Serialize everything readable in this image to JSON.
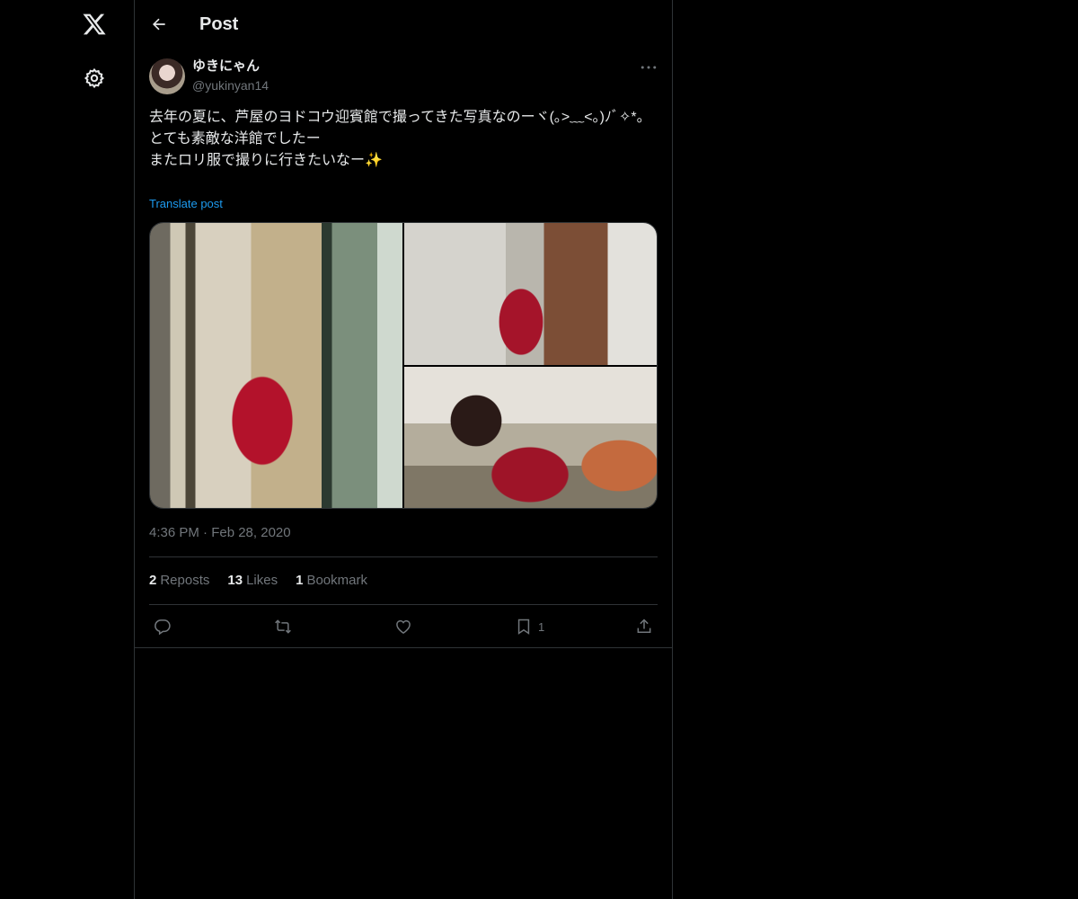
{
  "nav": {
    "logo_icon": "x-logo-icon",
    "settings_icon": "gear-icon"
  },
  "header": {
    "back_icon": "arrow-left-icon",
    "title": "Post"
  },
  "post": {
    "author": {
      "display_name": "ゆきにゃん",
      "handle": "@yukinyan14"
    },
    "more_icon": "more-icon",
    "text": "去年の夏に、芦屋のヨドコウ迎賓館で撮ってきた写真なのーヾ(｡>﹏<｡)ﾉﾞ✧*。\nとても素敵な洋館でしたー\nまたロリ服で撮りに行きたいなー✨",
    "translate_label": "Translate post",
    "media_count": 3,
    "timestamp": "4:36 PM · Feb 28, 2020",
    "stats": [
      {
        "count": "2",
        "label": "Reposts"
      },
      {
        "count": "13",
        "label": "Likes"
      },
      {
        "count": "1",
        "label": "Bookmark"
      }
    ],
    "actions": {
      "reply_icon": "reply-icon",
      "repost_icon": "repost-icon",
      "like_icon": "heart-icon",
      "bookmark_icon": "bookmark-icon",
      "bookmark_count": "1",
      "share_icon": "share-icon"
    }
  },
  "colors": {
    "background": "#000000",
    "text": "#e7e9ea",
    "muted": "#71767b",
    "accent": "#1d9bf0",
    "border": "#2f3336"
  }
}
